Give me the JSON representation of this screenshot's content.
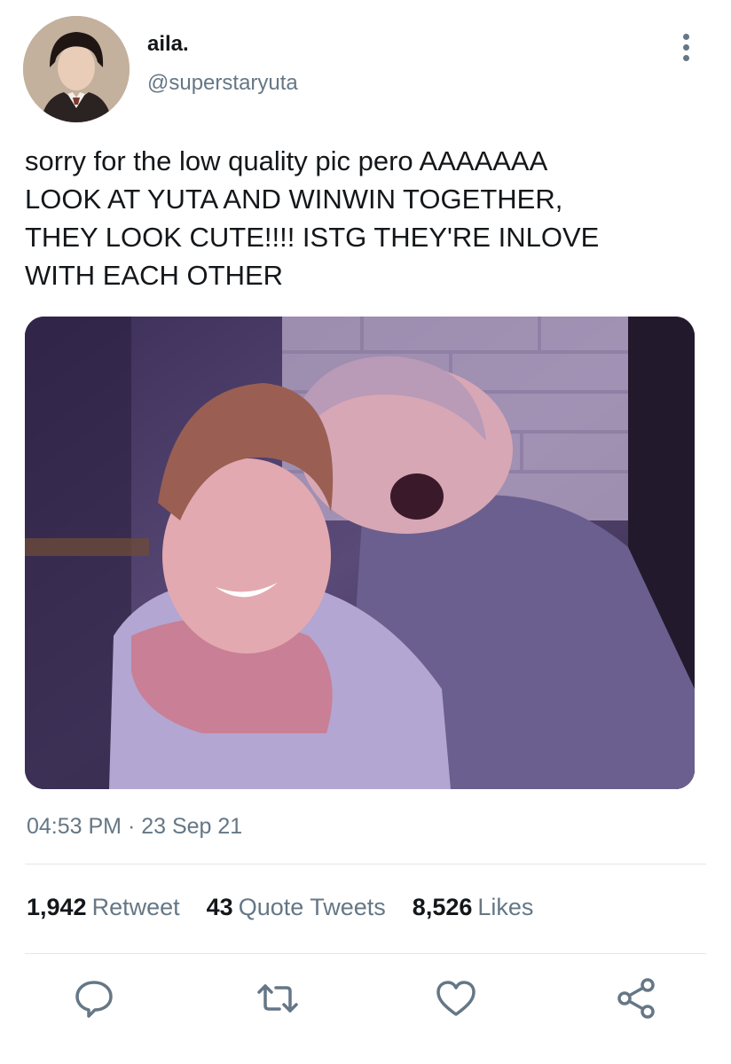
{
  "author": {
    "display_name": "aila.",
    "handle": "@superstaryuta",
    "avatar_icon": "profile-avatar"
  },
  "tweet": {
    "text": "sorry for the low quality pic pero AAAAAAA\nLOOK AT YUTA AND WINWIN TOGETHER,\nTHEY LOOK CUTE!!!! ISTG THEY'RE INLOVE\nWITH EACH OTHER",
    "timestamp": "04:53 PM · 23 Sep 21"
  },
  "stats": {
    "retweets_count": "1,942",
    "retweets_label": "Retweet",
    "quotes_count": "43",
    "quotes_label": "Quote Tweets",
    "likes_count": "8,526",
    "likes_label": "Likes"
  },
  "actions": {
    "reply_icon": "reply-icon",
    "retweet_icon": "retweet-icon",
    "like_icon": "heart-icon",
    "share_icon": "share-icon"
  },
  "colors": {
    "text_primary": "#14171a",
    "text_secondary": "#657786",
    "divider": "#e1e8ed"
  }
}
